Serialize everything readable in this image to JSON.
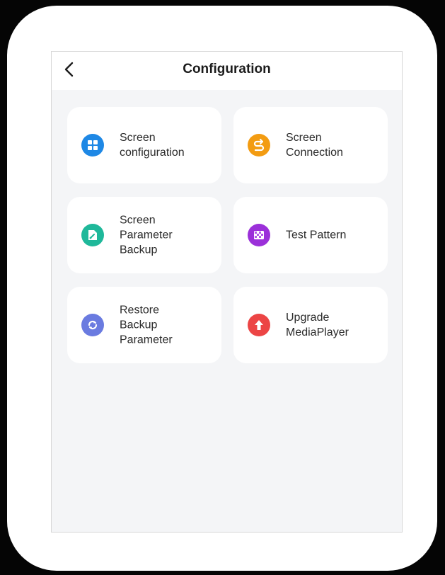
{
  "header": {
    "title": "Configuration",
    "back_icon": "chevron-left-icon"
  },
  "tiles": [
    {
      "label": "Screen\nconfiguration",
      "icon": "grid-icon",
      "color": "#1e88e5"
    },
    {
      "label": "Screen\nConnection",
      "icon": "connection-icon",
      "color": "#f39c12"
    },
    {
      "label": "Screen\nParameter\nBackup",
      "icon": "backup-icon",
      "color": "#1fb89a"
    },
    {
      "label": "Test Pattern",
      "icon": "checkerboard-icon",
      "color": "#9b30d9"
    },
    {
      "label": "Restore\nBackup\nParameter",
      "icon": "restore-icon",
      "color": "#6a7be0"
    },
    {
      "label": "Upgrade\nMediaPlayer",
      "icon": "upgrade-icon",
      "color": "#ec4545"
    }
  ]
}
